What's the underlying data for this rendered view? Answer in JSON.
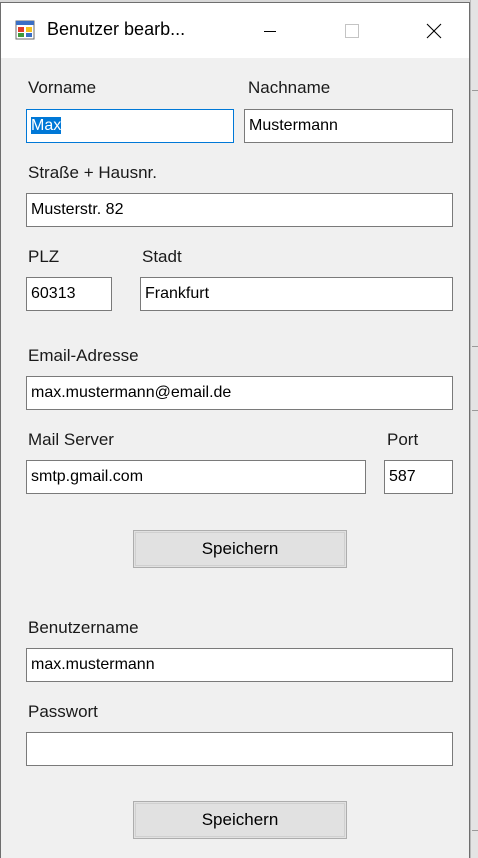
{
  "window": {
    "title": "Benutzer bearb..."
  },
  "icons": {
    "app": "form-app-icon",
    "minimize": "minimize-icon",
    "maximize": "maximize-icon",
    "close": "close-icon"
  },
  "labels": {
    "vorname": "Vorname",
    "nachname": "Nachname",
    "strasse": "Straße + Hausnr.",
    "plz": "PLZ",
    "stadt": "Stadt",
    "email": "Email-Adresse",
    "mailserver": "Mail Server",
    "port": "Port",
    "benutzername": "Benutzername",
    "passwort": "Passwort"
  },
  "fields": {
    "vorname": "Max",
    "nachname": "Mustermann",
    "strasse": "Musterstr. 82",
    "plz": "60313",
    "stadt": "Frankfurt",
    "email": "max.mustermann@email.de",
    "mailserver": "smtp.gmail.com",
    "port": "587",
    "benutzername": "max.mustermann",
    "passwort": ""
  },
  "buttons": {
    "save1": "Speichern",
    "save2": "Speichern"
  },
  "colors": {
    "focus": "#0078d7",
    "selection": "#0078d7",
    "window_bg": "#f0f0f0"
  }
}
